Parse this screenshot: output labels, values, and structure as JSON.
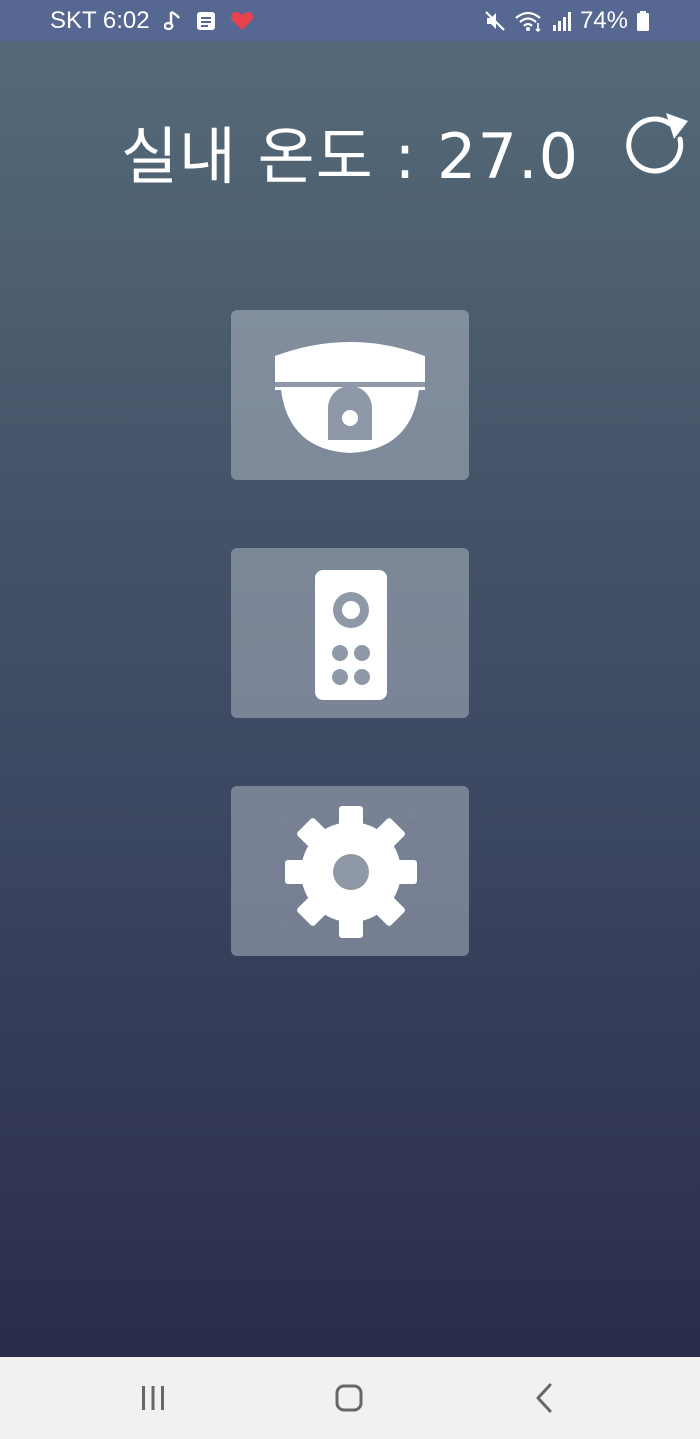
{
  "status_bar": {
    "carrier_time": "SKT 6:02",
    "battery_percent": "74%",
    "left_icons": [
      "music-note-icon",
      "notes-icon",
      "heart-icon"
    ],
    "right_icons": [
      "mute-icon",
      "wifi-icon",
      "signal-icon",
      "battery-icon"
    ]
  },
  "header": {
    "temperature_label": "실내 온도 : 27.0",
    "refresh_icon": "refresh-icon"
  },
  "menu": [
    {
      "name": "cctv",
      "icon": "security-camera-icon"
    },
    {
      "name": "remote",
      "icon": "remote-control-icon"
    },
    {
      "name": "settings",
      "icon": "gear-icon"
    }
  ],
  "nav_bar": {
    "buttons": [
      "recent-apps",
      "home",
      "back"
    ]
  },
  "colors": {
    "status_bar": "#566892",
    "gradient_top": "#556a78",
    "gradient_bottom": "#2a2d4a",
    "button_bg": "#8a95a4",
    "heart": "#e8424f",
    "nav_bar": "#f1f1f1"
  }
}
